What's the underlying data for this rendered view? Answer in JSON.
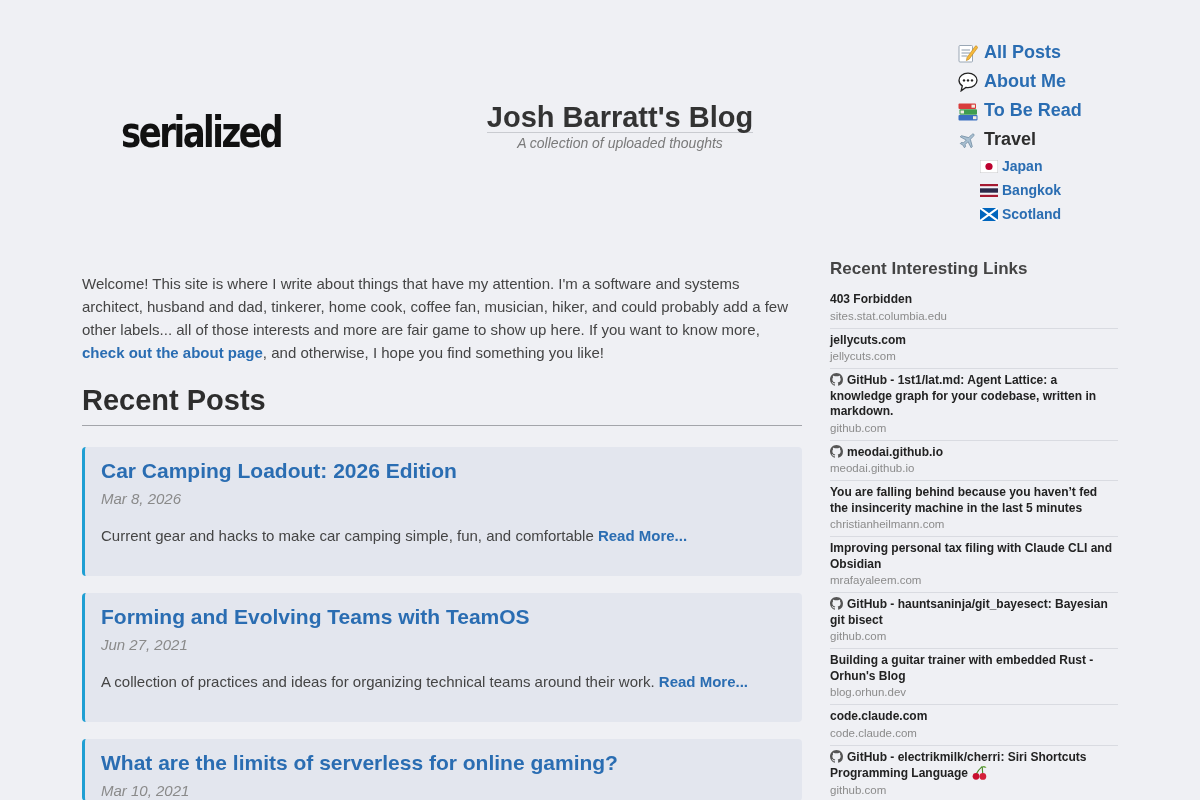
{
  "header": {
    "logo": "serialized",
    "title": "Josh Barratt's Blog",
    "subtitle": "A collection of uploaded thoughts"
  },
  "nav": [
    {
      "label": "All Posts",
      "kind": "memo",
      "link": true
    },
    {
      "label": "About Me",
      "kind": "speech",
      "link": true
    },
    {
      "label": "To Be Read",
      "kind": "books",
      "link": true
    },
    {
      "label": "Travel",
      "kind": "airplane",
      "link": false,
      "children": [
        {
          "label": "Japan",
          "kind": "japan",
          "link": true
        },
        {
          "label": "Bangkok",
          "kind": "thailand",
          "link": true
        },
        {
          "label": "Scotland",
          "kind": "scotland",
          "link": true
        }
      ]
    }
  ],
  "intro": {
    "text_before": "Welcome! This site is where I write about things that have my attention. I'm a software and systems architect, husband and dad, tinkerer, home cook, coffee fan, musician, hiker, and could probably add a few other labels... all of those interests and more are fair game to show up here. If you want to know more, ",
    "link": "check out the about page",
    "text_after": ", and otherwise, I hope you find something you like!"
  },
  "recent_posts": {
    "heading": "Recent Posts",
    "posts": [
      {
        "title": "Car Camping Loadout: 2026 Edition",
        "date": "Mar 8, 2026",
        "summary": "Current gear and hacks to make car camping simple, fun, and comfortable",
        "read_more": "Read More..."
      },
      {
        "title": "Forming and Evolving Teams with TeamOS",
        "date": "Jun 27, 2021",
        "summary": "A collection of practices and ideas for organizing technical teams around their work.",
        "read_more": "Read More..."
      },
      {
        "title": "What are the limits of serverless for online gaming?",
        "date": "Mar 10, 2021"
      }
    ]
  },
  "sidebar": {
    "heading": "Recent Interesting Links",
    "links": [
      {
        "title": "403 Forbidden",
        "domain": "sites.stat.columbia.edu",
        "kind": "page"
      },
      {
        "title": "jellycuts.com",
        "domain": "jellycuts.com",
        "kind": "page"
      },
      {
        "title": "GitHub - 1st1/lat.md: Agent Lattice: a knowledge graph for your codebase, written in markdown.",
        "domain": "github.com",
        "kind": "github"
      },
      {
        "title": "meodai.github.io",
        "domain": "meodai.github.io",
        "kind": "github"
      },
      {
        "title": "You are falling behind because you haven’t fed the insincerity machine in the last 5 minutes",
        "domain": "christianheilmann.com",
        "kind": "page"
      },
      {
        "title": "Improving personal tax filing with Claude CLI and Obsidian",
        "domain": "mrafayaleem.com",
        "kind": "page"
      },
      {
        "title": "GitHub - hauntsaninja/git_bayesect: Bayesian git bisect",
        "domain": "github.com",
        "kind": "github"
      },
      {
        "title": "Building a guitar trainer with embedded Rust - Orhun's Blog",
        "domain": "blog.orhun.dev",
        "kind": "page"
      },
      {
        "title": "code.claude.com",
        "domain": "code.claude.com",
        "kind": "page"
      },
      {
        "title": "GitHub - electrikmilk/cherri: Siri Shortcuts Programming Language",
        "domain": "github.com",
        "kind": "github",
        "suffix": {
          "kind": "cherries"
        }
      }
    ]
  }
}
